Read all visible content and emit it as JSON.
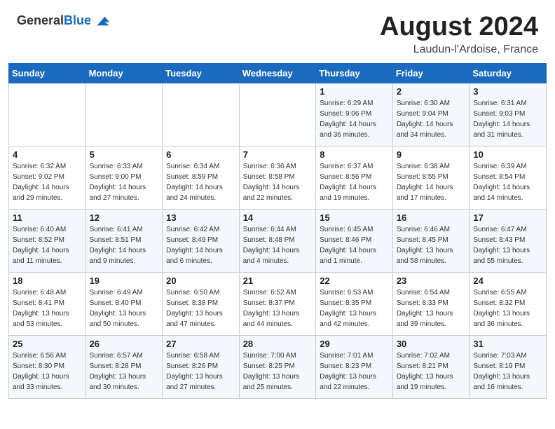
{
  "header": {
    "logo_general": "General",
    "logo_blue": "Blue",
    "month_year": "August 2024",
    "location": "Laudun-l'Ardoise, France"
  },
  "days_of_week": [
    "Sunday",
    "Monday",
    "Tuesday",
    "Wednesday",
    "Thursday",
    "Friday",
    "Saturday"
  ],
  "weeks": [
    [
      {
        "num": "",
        "info": ""
      },
      {
        "num": "",
        "info": ""
      },
      {
        "num": "",
        "info": ""
      },
      {
        "num": "",
        "info": ""
      },
      {
        "num": "1",
        "info": "Sunrise: 6:29 AM\nSunset: 9:06 PM\nDaylight: 14 hours\nand 36 minutes."
      },
      {
        "num": "2",
        "info": "Sunrise: 6:30 AM\nSunset: 9:04 PM\nDaylight: 14 hours\nand 34 minutes."
      },
      {
        "num": "3",
        "info": "Sunrise: 6:31 AM\nSunset: 9:03 PM\nDaylight: 14 hours\nand 31 minutes."
      }
    ],
    [
      {
        "num": "4",
        "info": "Sunrise: 6:32 AM\nSunset: 9:02 PM\nDaylight: 14 hours\nand 29 minutes."
      },
      {
        "num": "5",
        "info": "Sunrise: 6:33 AM\nSunset: 9:00 PM\nDaylight: 14 hours\nand 27 minutes."
      },
      {
        "num": "6",
        "info": "Sunrise: 6:34 AM\nSunset: 8:59 PM\nDaylight: 14 hours\nand 24 minutes."
      },
      {
        "num": "7",
        "info": "Sunrise: 6:36 AM\nSunset: 8:58 PM\nDaylight: 14 hours\nand 22 minutes."
      },
      {
        "num": "8",
        "info": "Sunrise: 6:37 AM\nSunset: 8:56 PM\nDaylight: 14 hours\nand 19 minutes."
      },
      {
        "num": "9",
        "info": "Sunrise: 6:38 AM\nSunset: 8:55 PM\nDaylight: 14 hours\nand 17 minutes."
      },
      {
        "num": "10",
        "info": "Sunrise: 6:39 AM\nSunset: 8:54 PM\nDaylight: 14 hours\nand 14 minutes."
      }
    ],
    [
      {
        "num": "11",
        "info": "Sunrise: 6:40 AM\nSunset: 8:52 PM\nDaylight: 14 hours\nand 11 minutes."
      },
      {
        "num": "12",
        "info": "Sunrise: 6:41 AM\nSunset: 8:51 PM\nDaylight: 14 hours\nand 9 minutes."
      },
      {
        "num": "13",
        "info": "Sunrise: 6:42 AM\nSunset: 8:49 PM\nDaylight: 14 hours\nand 6 minutes."
      },
      {
        "num": "14",
        "info": "Sunrise: 6:44 AM\nSunset: 8:48 PM\nDaylight: 14 hours\nand 4 minutes."
      },
      {
        "num": "15",
        "info": "Sunrise: 6:45 AM\nSunset: 8:46 PM\nDaylight: 14 hours\nand 1 minute."
      },
      {
        "num": "16",
        "info": "Sunrise: 6:46 AM\nSunset: 8:45 PM\nDaylight: 13 hours\nand 58 minutes."
      },
      {
        "num": "17",
        "info": "Sunrise: 6:47 AM\nSunset: 8:43 PM\nDaylight: 13 hours\nand 55 minutes."
      }
    ],
    [
      {
        "num": "18",
        "info": "Sunrise: 6:48 AM\nSunset: 8:41 PM\nDaylight: 13 hours\nand 53 minutes."
      },
      {
        "num": "19",
        "info": "Sunrise: 6:49 AM\nSunset: 8:40 PM\nDaylight: 13 hours\nand 50 minutes."
      },
      {
        "num": "20",
        "info": "Sunrise: 6:50 AM\nSunset: 8:38 PM\nDaylight: 13 hours\nand 47 minutes."
      },
      {
        "num": "21",
        "info": "Sunrise: 6:52 AM\nSunset: 8:37 PM\nDaylight: 13 hours\nand 44 minutes."
      },
      {
        "num": "22",
        "info": "Sunrise: 6:53 AM\nSunset: 8:35 PM\nDaylight: 13 hours\nand 42 minutes."
      },
      {
        "num": "23",
        "info": "Sunrise: 6:54 AM\nSunset: 8:33 PM\nDaylight: 13 hours\nand 39 minutes."
      },
      {
        "num": "24",
        "info": "Sunrise: 6:55 AM\nSunset: 8:32 PM\nDaylight: 13 hours\nand 36 minutes."
      }
    ],
    [
      {
        "num": "25",
        "info": "Sunrise: 6:56 AM\nSunset: 8:30 PM\nDaylight: 13 hours\nand 33 minutes."
      },
      {
        "num": "26",
        "info": "Sunrise: 6:57 AM\nSunset: 8:28 PM\nDaylight: 13 hours\nand 30 minutes."
      },
      {
        "num": "27",
        "info": "Sunrise: 6:58 AM\nSunset: 8:26 PM\nDaylight: 13 hours\nand 27 minutes."
      },
      {
        "num": "28",
        "info": "Sunrise: 7:00 AM\nSunset: 8:25 PM\nDaylight: 13 hours\nand 25 minutes."
      },
      {
        "num": "29",
        "info": "Sunrise: 7:01 AM\nSunset: 8:23 PM\nDaylight: 13 hours\nand 22 minutes."
      },
      {
        "num": "30",
        "info": "Sunrise: 7:02 AM\nSunset: 8:21 PM\nDaylight: 13 hours\nand 19 minutes."
      },
      {
        "num": "31",
        "info": "Sunrise: 7:03 AM\nSunset: 8:19 PM\nDaylight: 13 hours\nand 16 minutes."
      }
    ]
  ]
}
